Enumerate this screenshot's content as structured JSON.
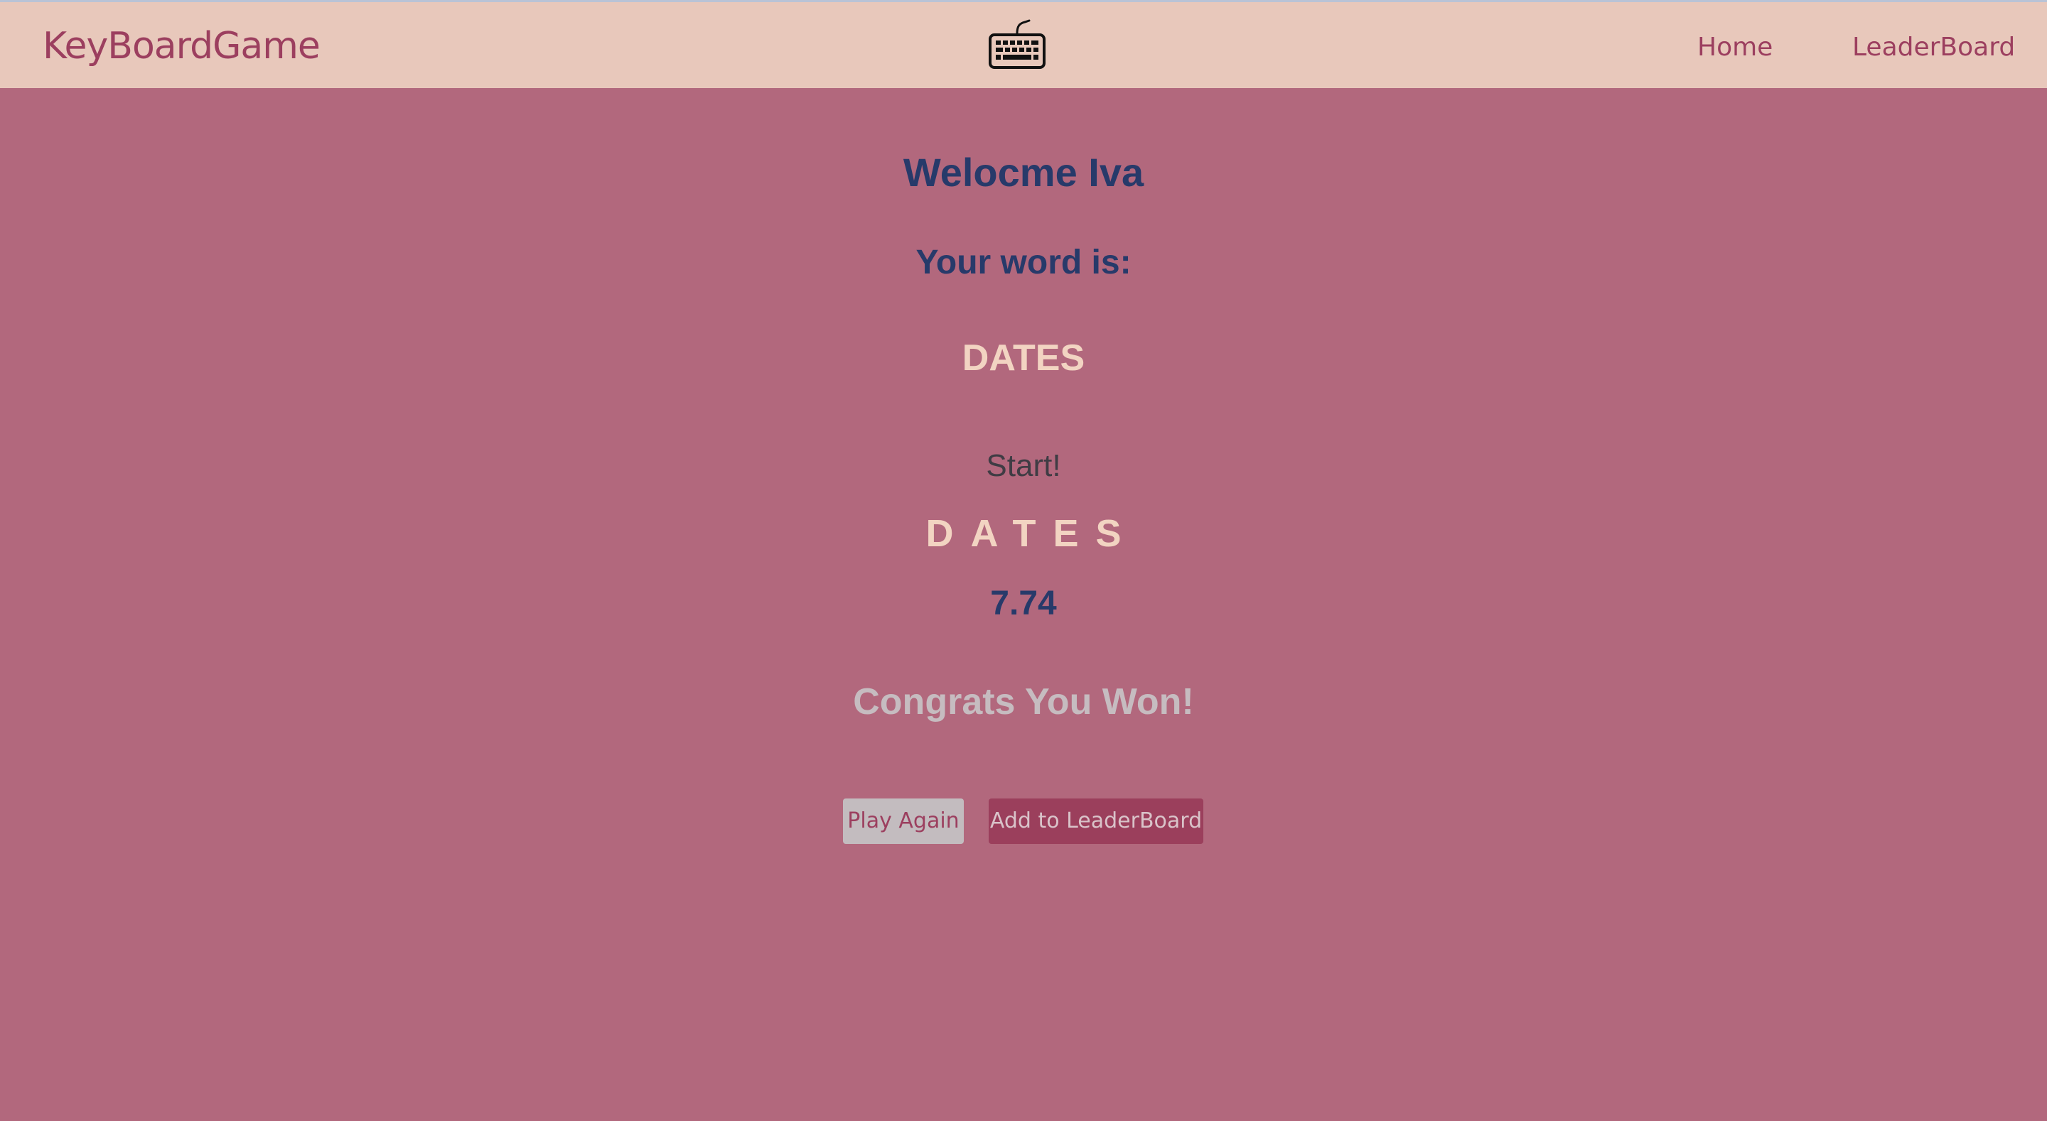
{
  "navbar": {
    "brand": "KeyBoardGame",
    "logo_icon": "keyboard-icon",
    "links": [
      {
        "label": "Home"
      },
      {
        "label": "LeaderBoard"
      }
    ]
  },
  "game": {
    "welcome": "Welocme Iva",
    "word_label": "Your word is:",
    "word": "DATES",
    "status": "Start!",
    "typed": "DATES",
    "time": "7.74",
    "result": "Congrats You Won!"
  },
  "actions": {
    "play_again": "Play Again",
    "add_to_leaderboard": "Add to LeaderBoard"
  },
  "colors": {
    "background": "#b2687d",
    "navbar": "#e8c8bb",
    "accent": "#9c3f5f",
    "heading": "#273a6a",
    "word": "#f2d4c2"
  }
}
